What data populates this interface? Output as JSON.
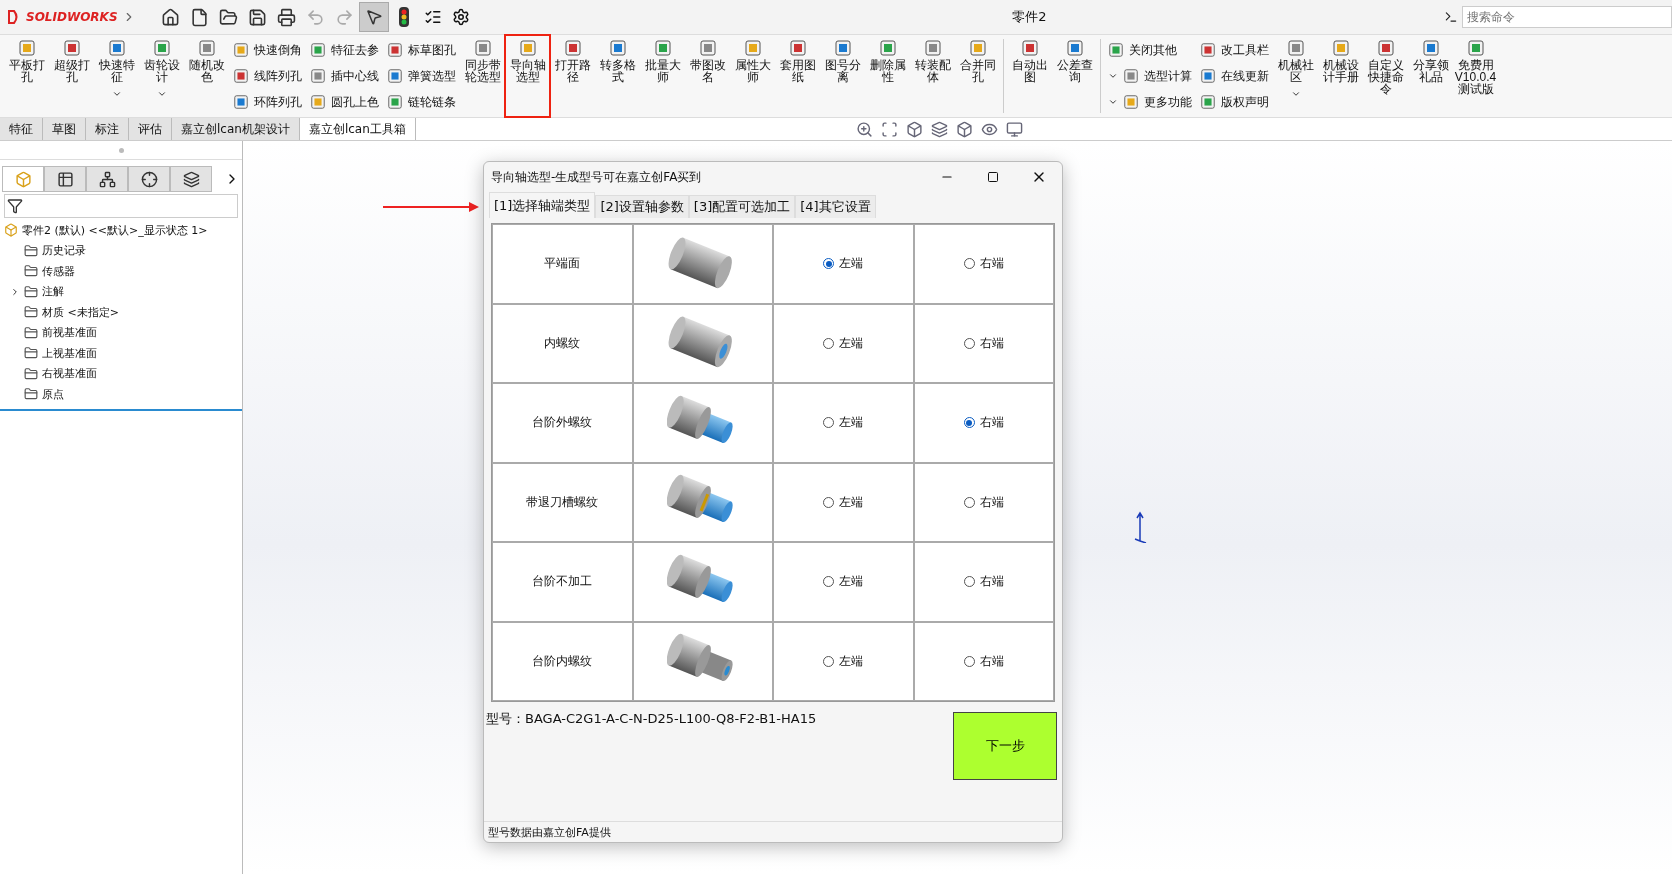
{
  "app": {
    "logo": "SOLIDWORKS",
    "title": "零件2",
    "search": {
      "placeholder": "搜索命令"
    }
  },
  "ribbon": [
    {
      "kind": "big",
      "label": "平板打孔",
      "dropdown": false,
      "highlighted": false
    },
    {
      "kind": "big",
      "label": "超级打孔",
      "dropdown": false,
      "highlighted": false
    },
    {
      "kind": "big",
      "label": "快速特征",
      "dropdown": true,
      "highlighted": false
    },
    {
      "kind": "big",
      "label": "齿轮设计",
      "dropdown": true,
      "highlighted": false
    },
    {
      "kind": "big",
      "label": "随机改色",
      "dropdown": false,
      "highlighted": false
    },
    {
      "kind": "stack",
      "items": [
        {
          "label": "快速倒角",
          "dropdown": false
        },
        {
          "label": "线阵列孔",
          "dropdown": false
        },
        {
          "label": "环阵列孔",
          "dropdown": false
        }
      ]
    },
    {
      "kind": "stack",
      "items": [
        {
          "label": "特征去参",
          "dropdown": false
        },
        {
          "label": "插中心线",
          "dropdown": false
        },
        {
          "label": "圆孔上色",
          "dropdown": false
        }
      ]
    },
    {
      "kind": "stack",
      "items": [
        {
          "label": "标草图孔",
          "dropdown": false
        },
        {
          "label": "弹簧选型",
          "dropdown": false
        },
        {
          "label": "链轮链条",
          "dropdown": false
        }
      ]
    },
    {
      "kind": "big",
      "label": "同步带轮选型",
      "dropdown": false,
      "highlighted": false
    },
    {
      "kind": "big",
      "label": "导向轴选型",
      "dropdown": false,
      "highlighted": true
    },
    {
      "kind": "big",
      "label": "打开路径",
      "dropdown": false,
      "highlighted": false
    },
    {
      "kind": "big",
      "label": "转多格式",
      "dropdown": false,
      "highlighted": false
    },
    {
      "kind": "big",
      "label": "批量大师",
      "dropdown": false,
      "highlighted": false
    },
    {
      "kind": "big",
      "label": "带图改名",
      "dropdown": false,
      "highlighted": false
    },
    {
      "kind": "big",
      "label": "属性大师",
      "dropdown": false,
      "highlighted": false
    },
    {
      "kind": "big",
      "label": "套用图纸",
      "dropdown": false,
      "highlighted": false
    },
    {
      "kind": "big",
      "label": "图号分离",
      "dropdown": false,
      "highlighted": false
    },
    {
      "kind": "big",
      "label": "删除属性",
      "dropdown": false,
      "highlighted": false
    },
    {
      "kind": "big",
      "label": "转装配体",
      "dropdown": false,
      "highlighted": false
    },
    {
      "kind": "big",
      "label": "合并同孔",
      "dropdown": false,
      "highlighted": false
    },
    {
      "kind": "separator"
    },
    {
      "kind": "big",
      "label": "自动出图",
      "dropdown": false,
      "highlighted": false
    },
    {
      "kind": "big",
      "label": "公差查询",
      "dropdown": false,
      "highlighted": false
    },
    {
      "kind": "separator"
    },
    {
      "kind": "stack",
      "items": [
        {
          "label": "关闭其他",
          "dropdown": false
        },
        {
          "label": "选型计算",
          "dropdown": true
        },
        {
          "label": "更多功能",
          "dropdown": true
        }
      ]
    },
    {
      "kind": "stack",
      "items": [
        {
          "label": "改工具栏",
          "dropdown": false
        },
        {
          "label": "在线更新",
          "dropdown": false
        },
        {
          "label": "版权声明",
          "dropdown": false
        }
      ]
    },
    {
      "kind": "big",
      "label": "机械社区",
      "dropdown": true,
      "highlighted": false
    },
    {
      "kind": "big",
      "label": "机械设计手册",
      "dropdown": false,
      "highlighted": false
    },
    {
      "kind": "big",
      "label": "自定义快捷命令",
      "dropdown": false,
      "highlighted": false
    },
    {
      "kind": "big",
      "label": "分享领礼品",
      "dropdown": false,
      "highlighted": false
    },
    {
      "kind": "big",
      "label": "免费用V10.0.4测试版",
      "dropdown": false,
      "highlighted": false
    }
  ],
  "tabs": [
    {
      "label": "特征",
      "selected": false
    },
    {
      "label": "草图",
      "selected": false
    },
    {
      "label": "标注",
      "selected": false
    },
    {
      "label": "评估",
      "selected": false
    },
    {
      "label": "嘉立创lcan机架设计",
      "selected": false
    },
    {
      "label": "嘉立创lcan工具箱",
      "selected": true
    }
  ],
  "panel_tabs": [
    {
      "selected": true
    },
    {
      "selected": false
    },
    {
      "selected": false
    },
    {
      "selected": false
    },
    {
      "selected": false
    }
  ],
  "tree": {
    "label": "零件2 (默认) <<默认>_显示状态 1>",
    "children": [
      {
        "label": "历史记录"
      },
      {
        "label": "传感器"
      },
      {
        "label": "注解",
        "expanded": false
      },
      {
        "label": "材质 <未指定>"
      },
      {
        "label": "前视基准面"
      },
      {
        "label": "上视基准面"
      },
      {
        "label": "右视基准面"
      },
      {
        "label": "原点"
      }
    ]
  },
  "dialog": {
    "title": "导向轴选型-生成型号可在嘉立创FA买到",
    "tabs": [
      {
        "label": "[1]选择轴端类型",
        "selected": true
      },
      {
        "label": "[2]设置轴参数",
        "selected": false
      },
      {
        "label": "[3]配置可选加工",
        "selected": false
      },
      {
        "label": "[4]其它设置",
        "selected": false
      }
    ],
    "rows": [
      {
        "name": "平端面",
        "kind": "plain",
        "left": {
          "label": "左端",
          "selected": true
        },
        "right": {
          "label": "右端",
          "selected": false
        }
      },
      {
        "name": "内螺纹",
        "kind": "inner-thread",
        "left": {
          "label": "左端",
          "selected": false
        },
        "right": {
          "label": "右端",
          "selected": false
        }
      },
      {
        "name": "台阶外螺纹",
        "kind": "step-thread",
        "left": {
          "label": "左端",
          "selected": false
        },
        "right": {
          "label": "右端",
          "selected": true
        }
      },
      {
        "name": "带退刀槽螺纹",
        "kind": "step-groove-thread",
        "left": {
          "label": "左端",
          "selected": false
        },
        "right": {
          "label": "右端",
          "selected": false
        }
      },
      {
        "name": "台阶不加工",
        "kind": "step-plain",
        "left": {
          "label": "左端",
          "selected": false
        },
        "right": {
          "label": "右端",
          "selected": false
        }
      },
      {
        "name": "台阶内螺纹",
        "kind": "step-inner-thread",
        "left": {
          "label": "左端",
          "selected": false
        },
        "right": {
          "label": "右端",
          "selected": false
        }
      }
    ],
    "model": "型号：BAGA-C2G1-A-C-N-D25-L100-Q8-F2-B1-HA15",
    "next_button": "下一步",
    "status": "型号数据由嘉立创FA提供"
  }
}
